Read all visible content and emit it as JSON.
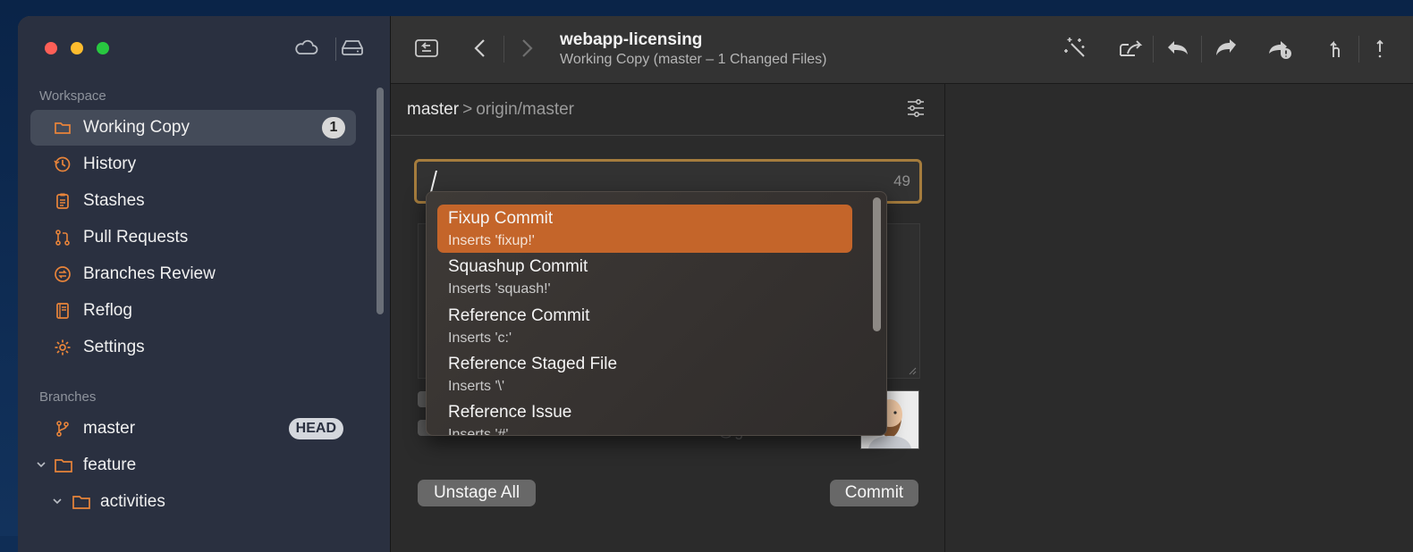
{
  "toolbar": {
    "title": "webapp-licensing",
    "subtitle": "Working Copy (master – 1 Changed Files)"
  },
  "sidebar": {
    "workspace_label": "Workspace",
    "items": [
      {
        "label": "Working Copy",
        "icon": "folder-icon",
        "badge": "1"
      },
      {
        "label": "History",
        "icon": "clock-icon"
      },
      {
        "label": "Stashes",
        "icon": "clipboard-icon"
      },
      {
        "label": "Pull Requests",
        "icon": "pull-request-icon"
      },
      {
        "label": "Branches Review",
        "icon": "branches-review-icon"
      },
      {
        "label": "Reflog",
        "icon": "book-icon"
      },
      {
        "label": "Settings",
        "icon": "gear-icon"
      }
    ],
    "branches_label": "Branches",
    "branches": [
      {
        "label": "master",
        "badge": "HEAD",
        "icon": "branch-icon"
      },
      {
        "label": "feature",
        "icon": "folder-icon"
      },
      {
        "label": "activities",
        "icon": "folder-icon"
      }
    ]
  },
  "breadcrumb": {
    "local": "master",
    "separator": ">",
    "remote": "origin/master"
  },
  "commit": {
    "message_count": "49",
    "email_partial": "bruno@git-tower.com",
    "unstage_label": "Unstage All",
    "commit_label": "Commit"
  },
  "autocomplete": [
    {
      "title": "Fixup Commit",
      "sub": "Inserts 'fixup!'"
    },
    {
      "title": "Squashup Commit",
      "sub": "Inserts 'squash!'"
    },
    {
      "title": "Reference Commit",
      "sub": "Inserts 'c:'"
    },
    {
      "title": "Reference Staged File",
      "sub": "Inserts '\\'"
    },
    {
      "title": "Reference Issue",
      "sub": "Inserts '#'"
    }
  ],
  "colors": {
    "accent": "#c4652a",
    "icon_orange": "#e8843a",
    "field_border": "#a57c3d"
  }
}
